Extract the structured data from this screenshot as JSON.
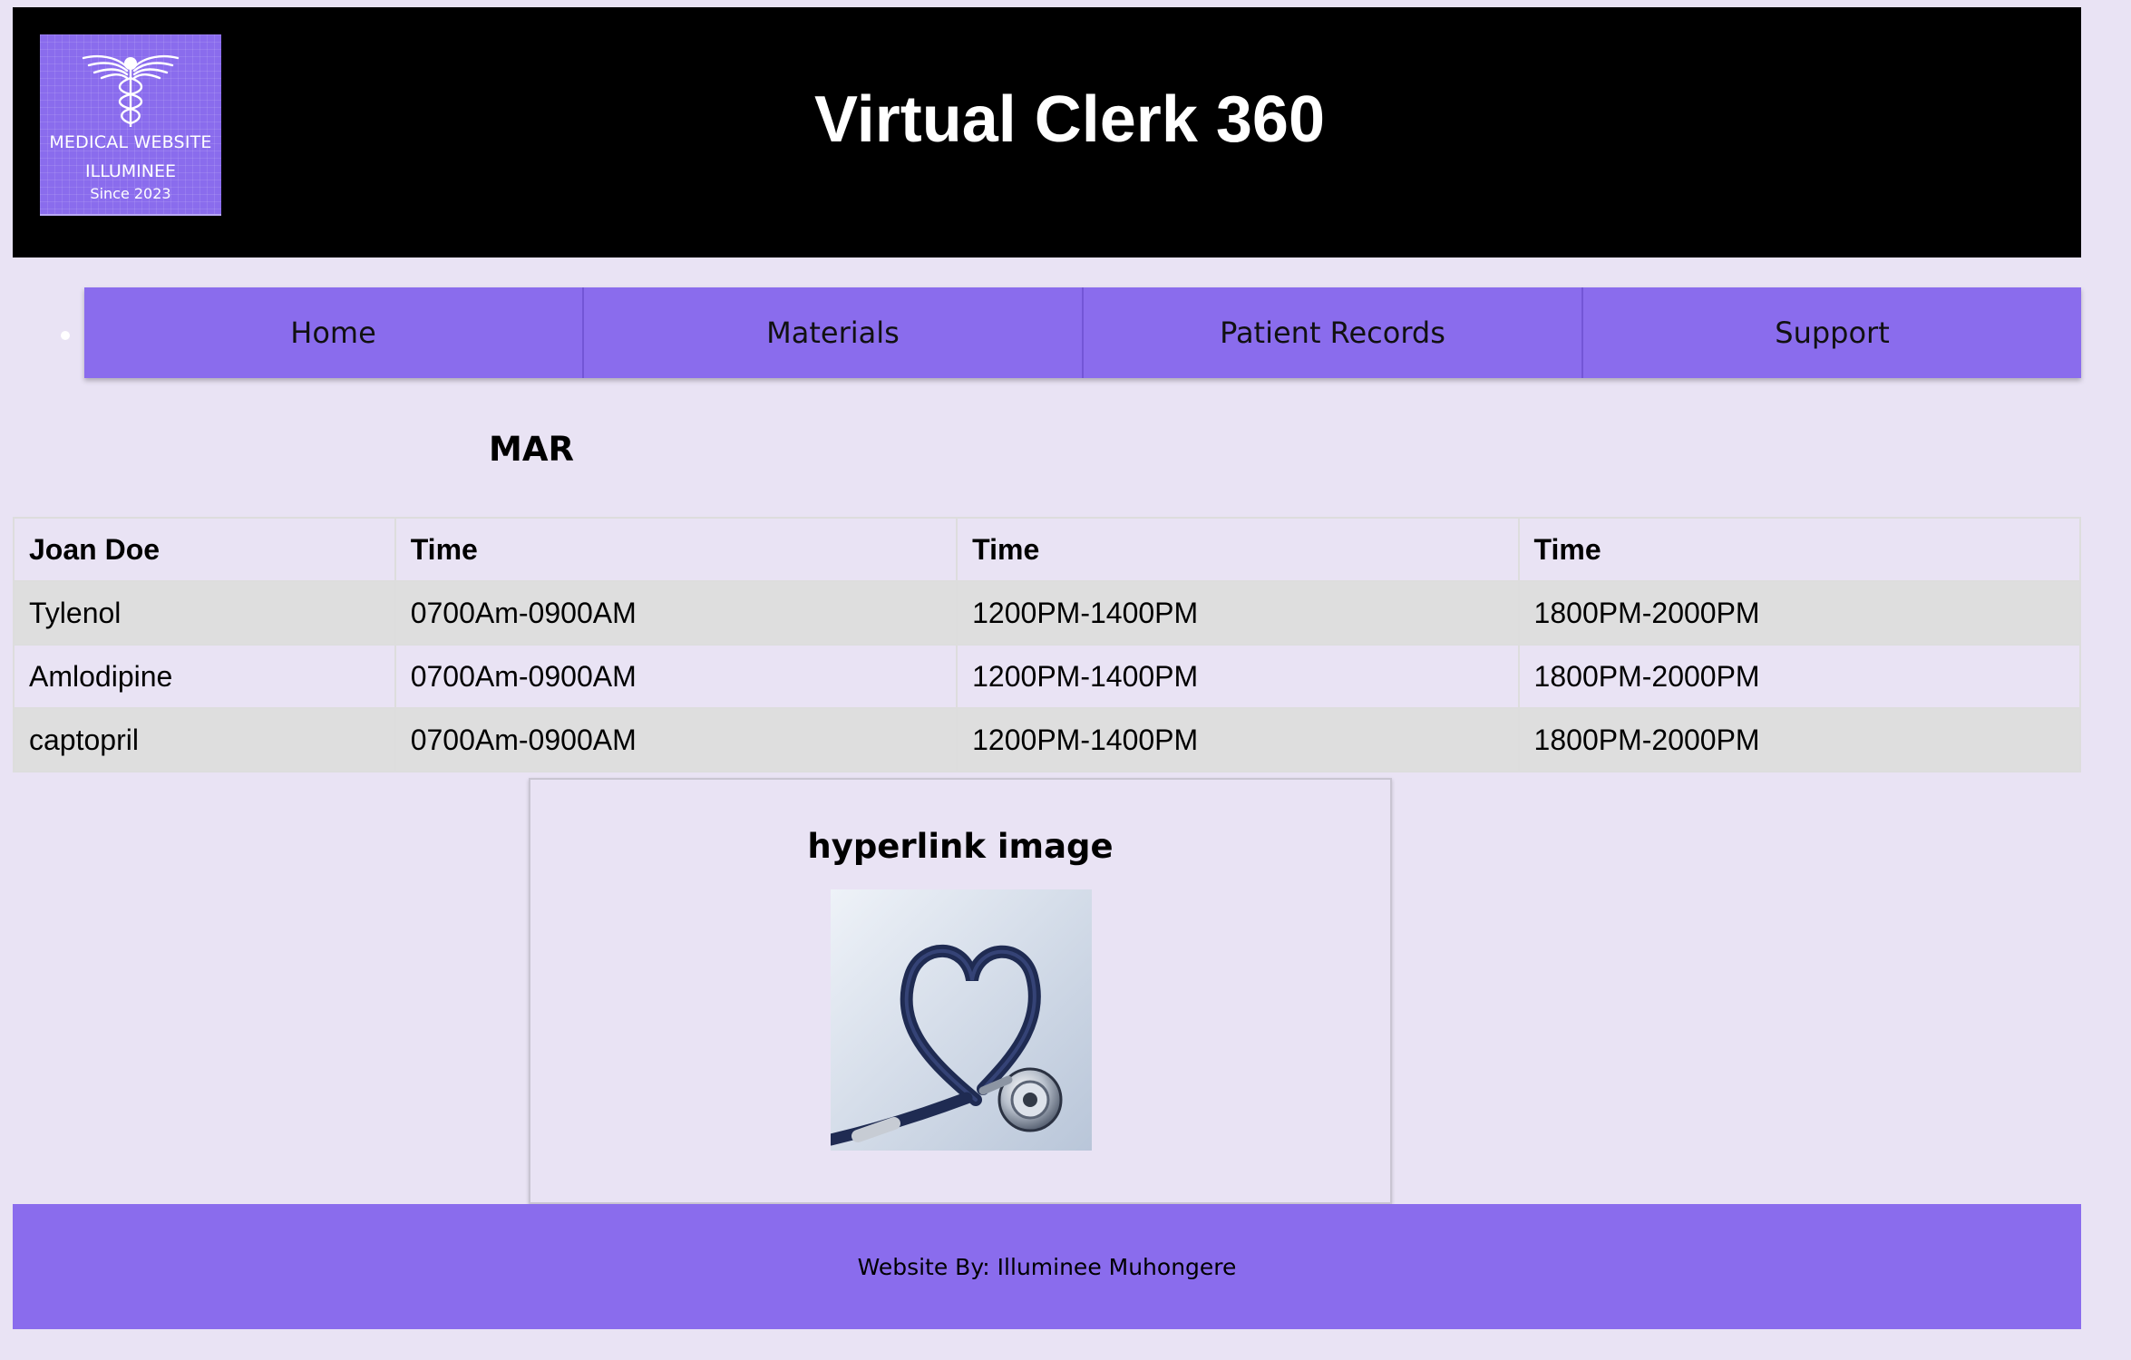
{
  "header": {
    "title": "Virtual Clerk 360",
    "logo": {
      "icon": "caduceus-icon",
      "line1": "MEDICAL WEBSITE",
      "line2": "ILLUMINEE",
      "line3": "Since 2023"
    }
  },
  "nav": {
    "items": [
      {
        "label": "Home"
      },
      {
        "label": "Materials"
      },
      {
        "label": "Patient Records"
      },
      {
        "label": "Support"
      }
    ]
  },
  "mar": {
    "heading": "MAR",
    "columns": [
      "Joan Doe",
      "Time",
      "Time",
      "Time"
    ],
    "rows": [
      {
        "medication": "Tylenol",
        "times": [
          "0700Am-0900AM",
          "1200PM-1400PM",
          "1800PM-2000PM"
        ]
      },
      {
        "medication": "Amlodipine",
        "times": [
          "0700Am-0900AM",
          "1200PM-1400PM",
          "1800PM-2000PM"
        ]
      },
      {
        "medication": "captopril",
        "times": [
          "0700Am-0900AM",
          "1200PM-1400PM",
          "1800PM-2000PM"
        ]
      }
    ]
  },
  "card": {
    "title": "hyperlink image",
    "image": "heart-stethoscope-image"
  },
  "footer": {
    "text": "Website By: Illuminee Muhongere"
  },
  "colors": {
    "page_background": "#e9e3f4",
    "accent": "#8a6ced",
    "header_background": "#000000",
    "striped_row": "#dedede"
  }
}
